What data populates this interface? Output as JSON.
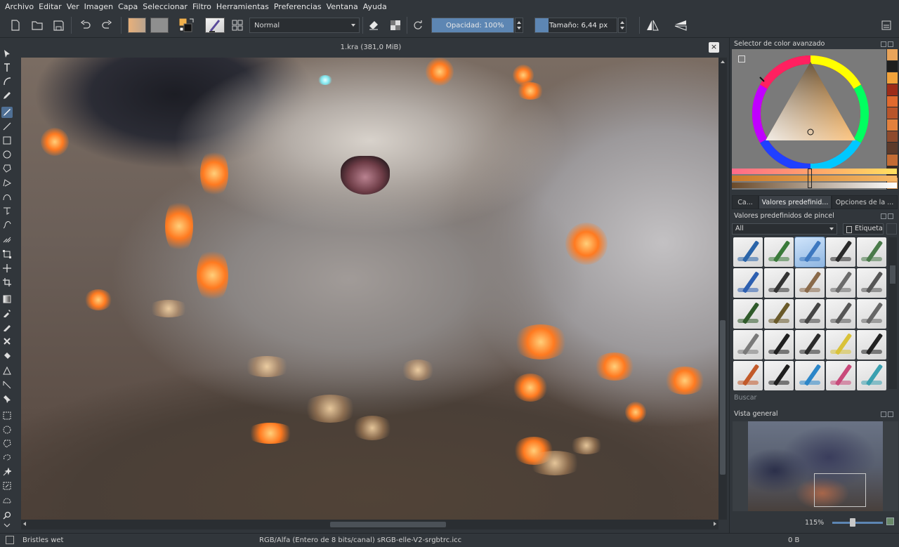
{
  "menu": [
    "Archivo",
    "Editar",
    "Ver",
    "Imagen",
    "Capa",
    "Seleccionar",
    "Filtro",
    "Herramientas",
    "Preferencias",
    "Ventana",
    "Ayuda"
  ],
  "toolbar": {
    "blend_mode": "Normal",
    "opacity_label": "Opacidad:",
    "opacity_value": "100%",
    "opacity_level": 1.0,
    "size_label": "Tamaño:",
    "size_value": "6,44 px",
    "size_level": 0.06,
    "icons": [
      "new-document-icon",
      "open-document-icon",
      "save-icon",
      "undo-icon",
      "redo-icon",
      "gradient-swatch-icon",
      "pattern-swatch-icon",
      "color-swap-icon",
      "brush-preset-icon",
      "workspace-icon",
      "eraser-icon",
      "alpha-lock-icon",
      "reload-preset-icon",
      "mirror-horizontal-icon",
      "mirror-vertical-icon",
      "settings-icon"
    ]
  },
  "toolbox": {
    "tools": [
      "select-shapes-icon",
      "text-icon",
      "calligraphy-icon",
      "edit-shapes-icon",
      "freehand-brush-icon",
      "line-icon",
      "rectangle-icon",
      "ellipse-icon",
      "polygon-icon",
      "polyline-icon",
      "bezier-icon",
      "freehand-path-icon",
      "dynamic-brush-icon",
      "multibrush-icon",
      "transform-icon",
      "move-icon",
      "crop-icon",
      "gradient-icon",
      "color-picker-icon",
      "colorize-mask-icon",
      "smart-patch-icon",
      "fill-icon",
      "assistant-icon",
      "measure-icon",
      "reference-images-icon",
      "rect-select-icon",
      "ellipse-select-icon",
      "polygon-select-icon",
      "freehand-select-icon",
      "contiguous-select-icon",
      "similar-select-icon",
      "bezier-select-icon",
      "zoom-icon",
      "pan-icon"
    ],
    "active_index": 4
  },
  "document": {
    "title": "1.kra (381,0 MiB)"
  },
  "dock": {
    "color_selector_title": "Selector de color avanzado",
    "palette": [
      "#e9a45a",
      "#1e1e1e",
      "#f2a33c",
      "#9d2c18",
      "#e06a2e",
      "#b8552a",
      "#e3813d",
      "#8e4a2c",
      "#5c3a2a",
      "#c46c34",
      "#3a2a24",
      "#d99a5c"
    ],
    "tabs": [
      "Ca...",
      "Valores predefinid...",
      "Opciones de la ..."
    ],
    "active_tab": 1,
    "brush_presets_title": "Valores predefinidos de pincel",
    "brush_filter": "All",
    "tag_label": "Etiqueta",
    "brushes": [
      {
        "name": "brush-preset-1",
        "color": "#2a64a8"
      },
      {
        "name": "brush-preset-2",
        "color": "#3a7a3a"
      },
      {
        "name": "brush-preset-3",
        "color": "#3d78c0"
      },
      {
        "name": "brush-preset-4",
        "color": "#2a2a2a"
      },
      {
        "name": "brush-preset-5",
        "color": "#4a7a4a"
      },
      {
        "name": "brush-preset-6",
        "color": "#2d5fb0"
      },
      {
        "name": "brush-preset-7",
        "color": "#333333"
      },
      {
        "name": "brush-preset-8",
        "color": "#8a6a4a"
      },
      {
        "name": "brush-preset-9",
        "color": "#6a6a6a"
      },
      {
        "name": "brush-preset-10",
        "color": "#555555"
      },
      {
        "name": "brush-preset-11",
        "color": "#2f5a2a"
      },
      {
        "name": "brush-preset-12",
        "color": "#6a5a2a"
      },
      {
        "name": "brush-preset-13",
        "color": "#444444"
      },
      {
        "name": "brush-preset-14",
        "color": "#555555"
      },
      {
        "name": "brush-preset-15",
        "color": "#666666"
      },
      {
        "name": "brush-preset-16",
        "color": "#7a7a7a"
      },
      {
        "name": "brush-preset-17",
        "color": "#1f1f1f"
      },
      {
        "name": "brush-preset-18",
        "color": "#2a2a2a"
      },
      {
        "name": "brush-preset-19",
        "color": "#d9c23a"
      },
      {
        "name": "brush-preset-20",
        "color": "#222222"
      },
      {
        "name": "brush-preset-21",
        "color": "#c25a2a"
      },
      {
        "name": "brush-preset-22",
        "color": "#1e1e1e"
      },
      {
        "name": "brush-preset-23",
        "color": "#2c86c8"
      },
      {
        "name": "brush-preset-24",
        "color": "#c84a7a"
      },
      {
        "name": "brush-preset-25",
        "color": "#3aa0b0"
      }
    ],
    "selected_brush": 2,
    "search_placeholder": "Buscar",
    "overview_title": "Vista general",
    "zoom_label": "115%"
  },
  "status": {
    "brush": "Bristles wet",
    "color_info": "RGB/Alfa (Entero de 8 bits/canal)  sRGB-elle-V2-srgbtrc.icc",
    "memory": "0 B"
  }
}
